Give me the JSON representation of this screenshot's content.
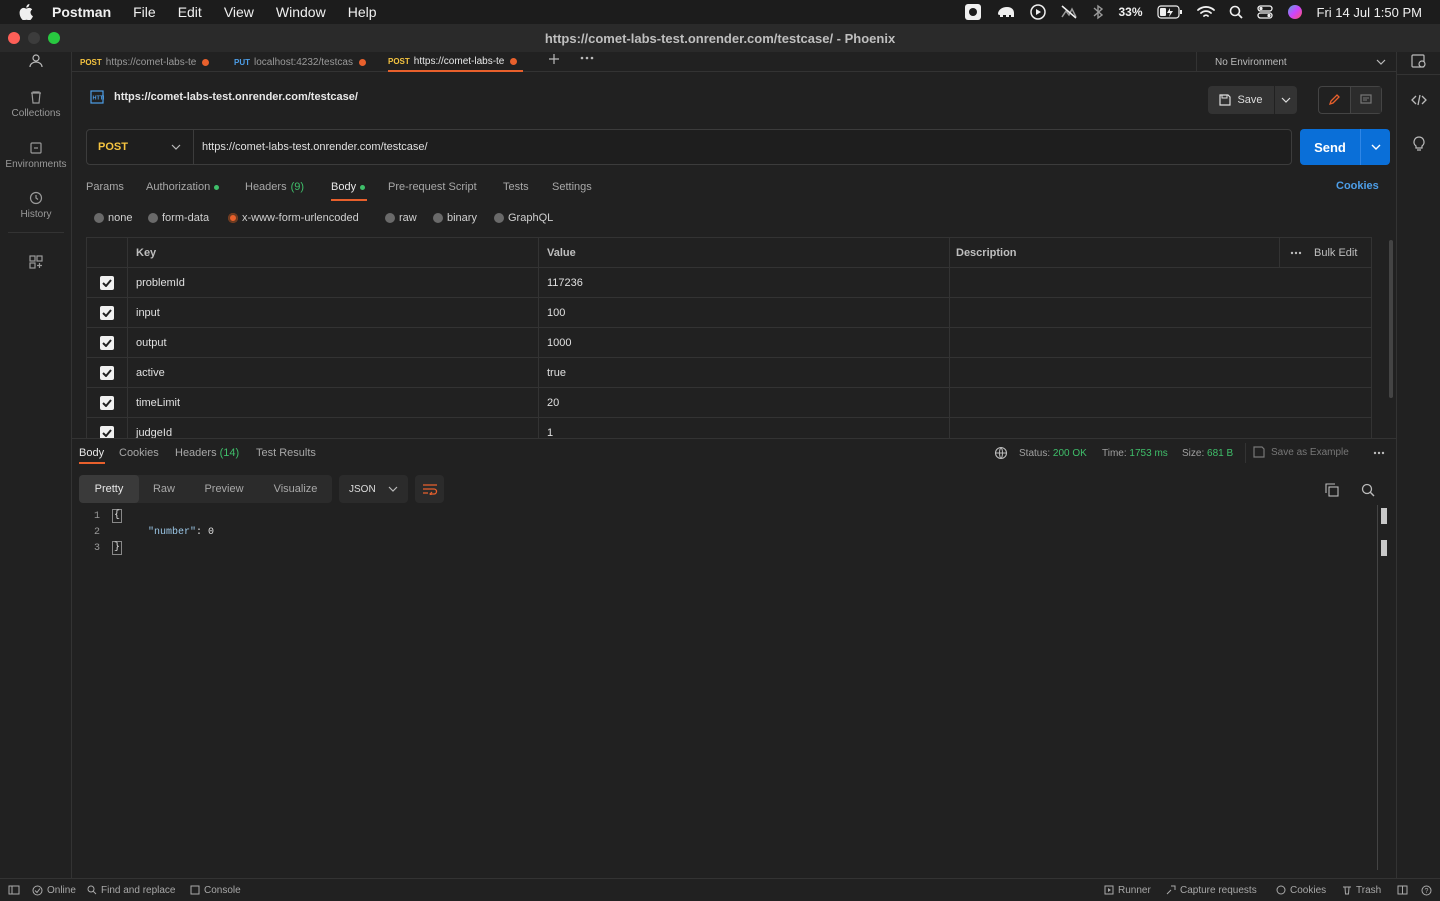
{
  "menubar": {
    "app": "Postman",
    "items": [
      "File",
      "Edit",
      "View",
      "Window",
      "Help"
    ],
    "battery": "33%",
    "datetime": "Fri 14 Jul  1:50 PM"
  },
  "window": {
    "title": "https://comet-labs-test.onrender.com/testcase/ - Phoenix"
  },
  "sidebar": {
    "items": [
      {
        "label": "Collections",
        "icon": "trash-bin-icon"
      },
      {
        "label": "Environments",
        "icon": "environment-icon"
      },
      {
        "label": "History",
        "icon": "history-icon"
      }
    ]
  },
  "tabs": [
    {
      "method": "POST",
      "label": "https://comet-labs-te",
      "method_color": "#f5c440"
    },
    {
      "method": "PUT",
      "label": "localhost:4232/testcas",
      "method_color": "#4d9ee8"
    },
    {
      "method": "POST",
      "label": "https://comet-labs-te",
      "method_color": "#f5c440"
    }
  ],
  "environment": "No Environment",
  "request": {
    "title": "https://comet-labs-test.onrender.com/testcase/",
    "save_label": "Save",
    "method": "POST",
    "url": "https://comet-labs-test.onrender.com/testcase/",
    "send_label": "Send"
  },
  "request_tabs": {
    "params": "Params",
    "authorization": "Authorization",
    "headers": "Headers",
    "headers_count": "(9)",
    "body": "Body",
    "prerequest": "Pre-request Script",
    "tests": "Tests",
    "settings": "Settings",
    "cookies": "Cookies"
  },
  "body_types": [
    "none",
    "form-data",
    "x-www-form-urlencoded",
    "raw",
    "binary",
    "GraphQL"
  ],
  "kv_table": {
    "headers": {
      "key": "Key",
      "value": "Value",
      "description": "Description",
      "bulk_edit": "Bulk Edit"
    },
    "rows": [
      {
        "key": "problemId",
        "value": "117236"
      },
      {
        "key": "input",
        "value": "100"
      },
      {
        "key": "output",
        "value": "1000"
      },
      {
        "key": "active",
        "value": "true"
      },
      {
        "key": "timeLimit",
        "value": "20"
      },
      {
        "key": "judgeId",
        "value": "1"
      }
    ]
  },
  "response": {
    "tabs": {
      "body": "Body",
      "cookies": "Cookies",
      "headers": "Headers",
      "headers_count": "(14)",
      "test_results": "Test Results"
    },
    "status_label": "Status:",
    "status": "200 OK",
    "time_label": "Time:",
    "time": "1753 ms",
    "size_label": "Size:",
    "size": "681 B",
    "save_example": "Save as Example",
    "formats": [
      "Pretty",
      "Raw",
      "Preview",
      "Visualize"
    ],
    "language": "JSON",
    "code": {
      "line1": "{",
      "line2_key": "\"number\"",
      "line2_rest": ": 0",
      "line3": "}"
    }
  },
  "footer": {
    "online": "Online",
    "find_replace": "Find and replace",
    "console": "Console",
    "runner": "Runner",
    "capture": "Capture requests",
    "cookies": "Cookies",
    "trash": "Trash"
  }
}
